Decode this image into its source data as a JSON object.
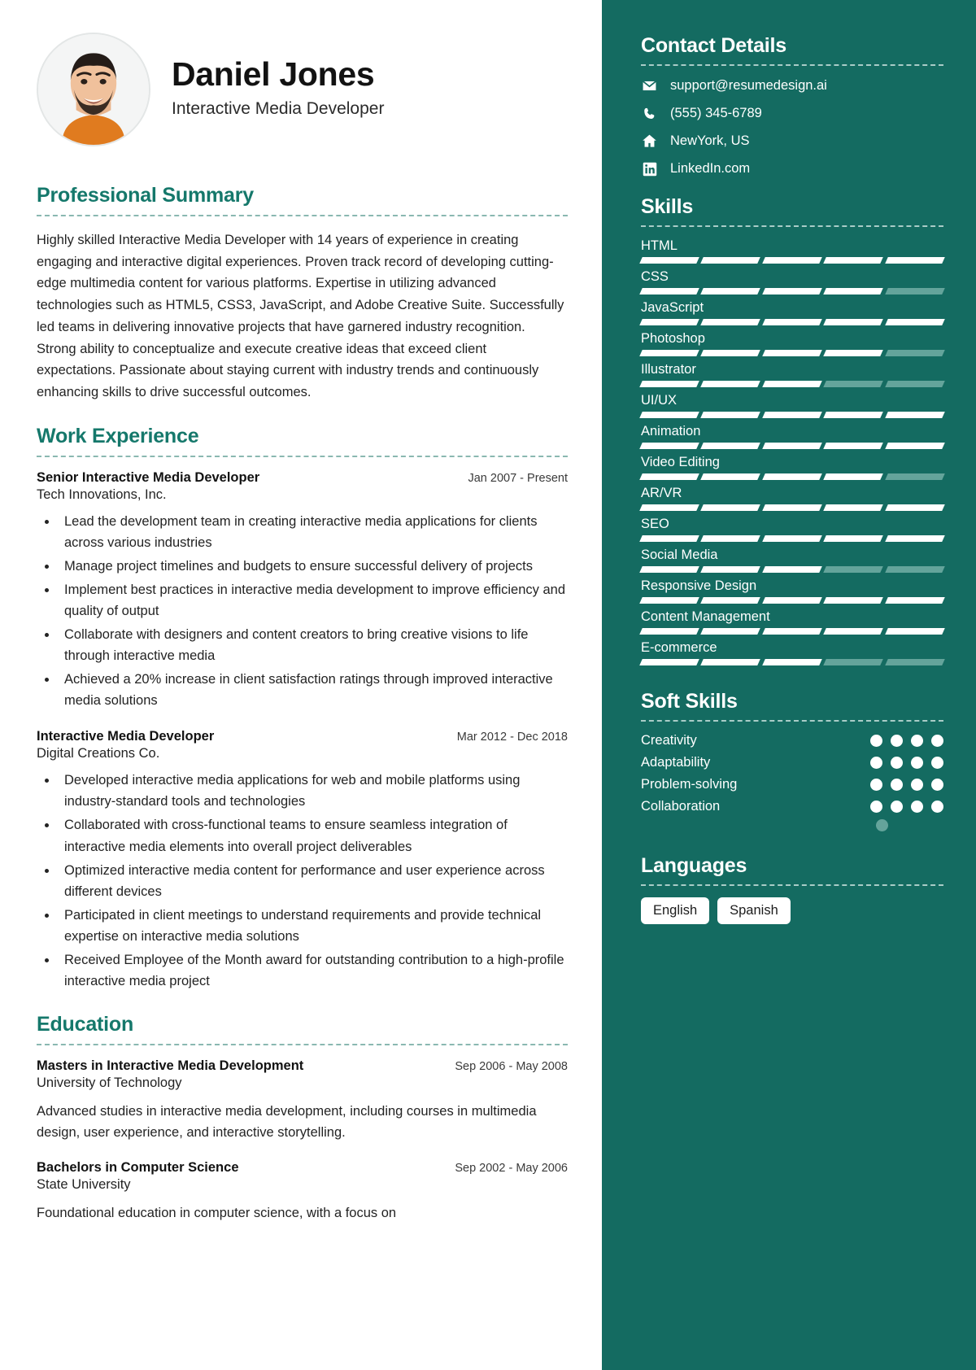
{
  "theme": {
    "accent": "#146b61",
    "accent_text": "#15786b",
    "muted_bar": "#64a49b"
  },
  "header": {
    "name": "Daniel Jones",
    "role": "Interactive Media Developer",
    "avatar_icon": "profile-photo"
  },
  "summary": {
    "title": "Professional Summary",
    "text": "Highly skilled Interactive Media Developer with 14 years of experience in creating engaging and interactive digital experiences. Proven track record of developing cutting-edge multimedia content for various platforms. Expertise in utilizing advanced technologies such as HTML5, CSS3, JavaScript, and Adobe Creative Suite. Successfully led teams in delivering innovative projects that have garnered industry recognition. Strong ability to conceptualize and execute creative ideas that exceed client expectations. Passionate about staying current with industry trends and continuously enhancing skills to drive successful outcomes."
  },
  "work": {
    "title": "Work Experience",
    "entries": [
      {
        "title": "Senior Interactive Media Developer",
        "date": "Jan 2007 - Present",
        "org": "Tech Innovations, Inc.",
        "bullets": [
          "Lead the development team in creating interactive media applications for clients across various industries",
          "Manage project timelines and budgets to ensure successful delivery of projects",
          "Implement best practices in interactive media development to improve efficiency and quality of output",
          "Collaborate with designers and content creators to bring creative visions to life through interactive media",
          "Achieved a 20% increase in client satisfaction ratings through improved interactive media solutions"
        ]
      },
      {
        "title": "Interactive Media Developer",
        "date": "Mar 2012 - Dec 2018",
        "org": "Digital Creations Co.",
        "bullets": [
          "Developed interactive media applications for web and mobile platforms using industry-standard tools and technologies",
          "Collaborated with cross-functional teams to ensure seamless integration of interactive media elements into overall project deliverables",
          "Optimized interactive media content for performance and user experience across different devices",
          "Participated in client meetings to understand requirements and provide technical expertise on interactive media solutions",
          "Received Employee of the Month award for outstanding contribution to a high-profile interactive media project"
        ]
      }
    ]
  },
  "education": {
    "title": "Education",
    "entries": [
      {
        "title": "Masters in Interactive Media Development",
        "date": "Sep 2006 - May 2008",
        "org": "University of Technology",
        "desc": "Advanced studies in interactive media development, including courses in multimedia design, user experience, and interactive storytelling."
      },
      {
        "title": "Bachelors in Computer Science",
        "date": "Sep 2002 - May 2006",
        "org": "State University",
        "desc": "Foundational education in computer science, with a focus on"
      }
    ]
  },
  "contact": {
    "title": "Contact Details",
    "items": [
      {
        "icon": "envelope-icon",
        "text": "support@resumedesign.ai"
      },
      {
        "icon": "phone-icon",
        "text": "(555) 345-6789"
      },
      {
        "icon": "home-icon",
        "text": "NewYork, US"
      },
      {
        "icon": "linkedin-icon",
        "text": "LinkedIn.com"
      }
    ]
  },
  "skills": {
    "title": "Skills",
    "segments": 5,
    "items": [
      {
        "label": "HTML",
        "filled": 5
      },
      {
        "label": "CSS",
        "filled": 4
      },
      {
        "label": "JavaScript",
        "filled": 5
      },
      {
        "label": "Photoshop",
        "filled": 4
      },
      {
        "label": "Illustrator",
        "filled": 3
      },
      {
        "label": "UI/UX",
        "filled": 5
      },
      {
        "label": "Animation",
        "filled": 5
      },
      {
        "label": "Video Editing",
        "filled": 4
      },
      {
        "label": "AR/VR",
        "filled": 5
      },
      {
        "label": "SEO",
        "filled": 5
      },
      {
        "label": "Social Media",
        "filled": 3
      },
      {
        "label": "Responsive Design",
        "filled": 5
      },
      {
        "label": "Content Management",
        "filled": 5
      },
      {
        "label": "E-commerce",
        "filled": 3
      }
    ]
  },
  "soft_skills": {
    "title": "Soft Skills",
    "max_dots": 4,
    "items": [
      {
        "label": "Creativity",
        "filled": 4
      },
      {
        "label": "Adaptability",
        "filled": 4
      },
      {
        "label": "Problem-solving",
        "filled": 4
      },
      {
        "label": "Collaboration",
        "filled": 4
      }
    ],
    "trailing_dot": "off"
  },
  "languages": {
    "title": "Languages",
    "items": [
      "English",
      "Spanish"
    ]
  }
}
